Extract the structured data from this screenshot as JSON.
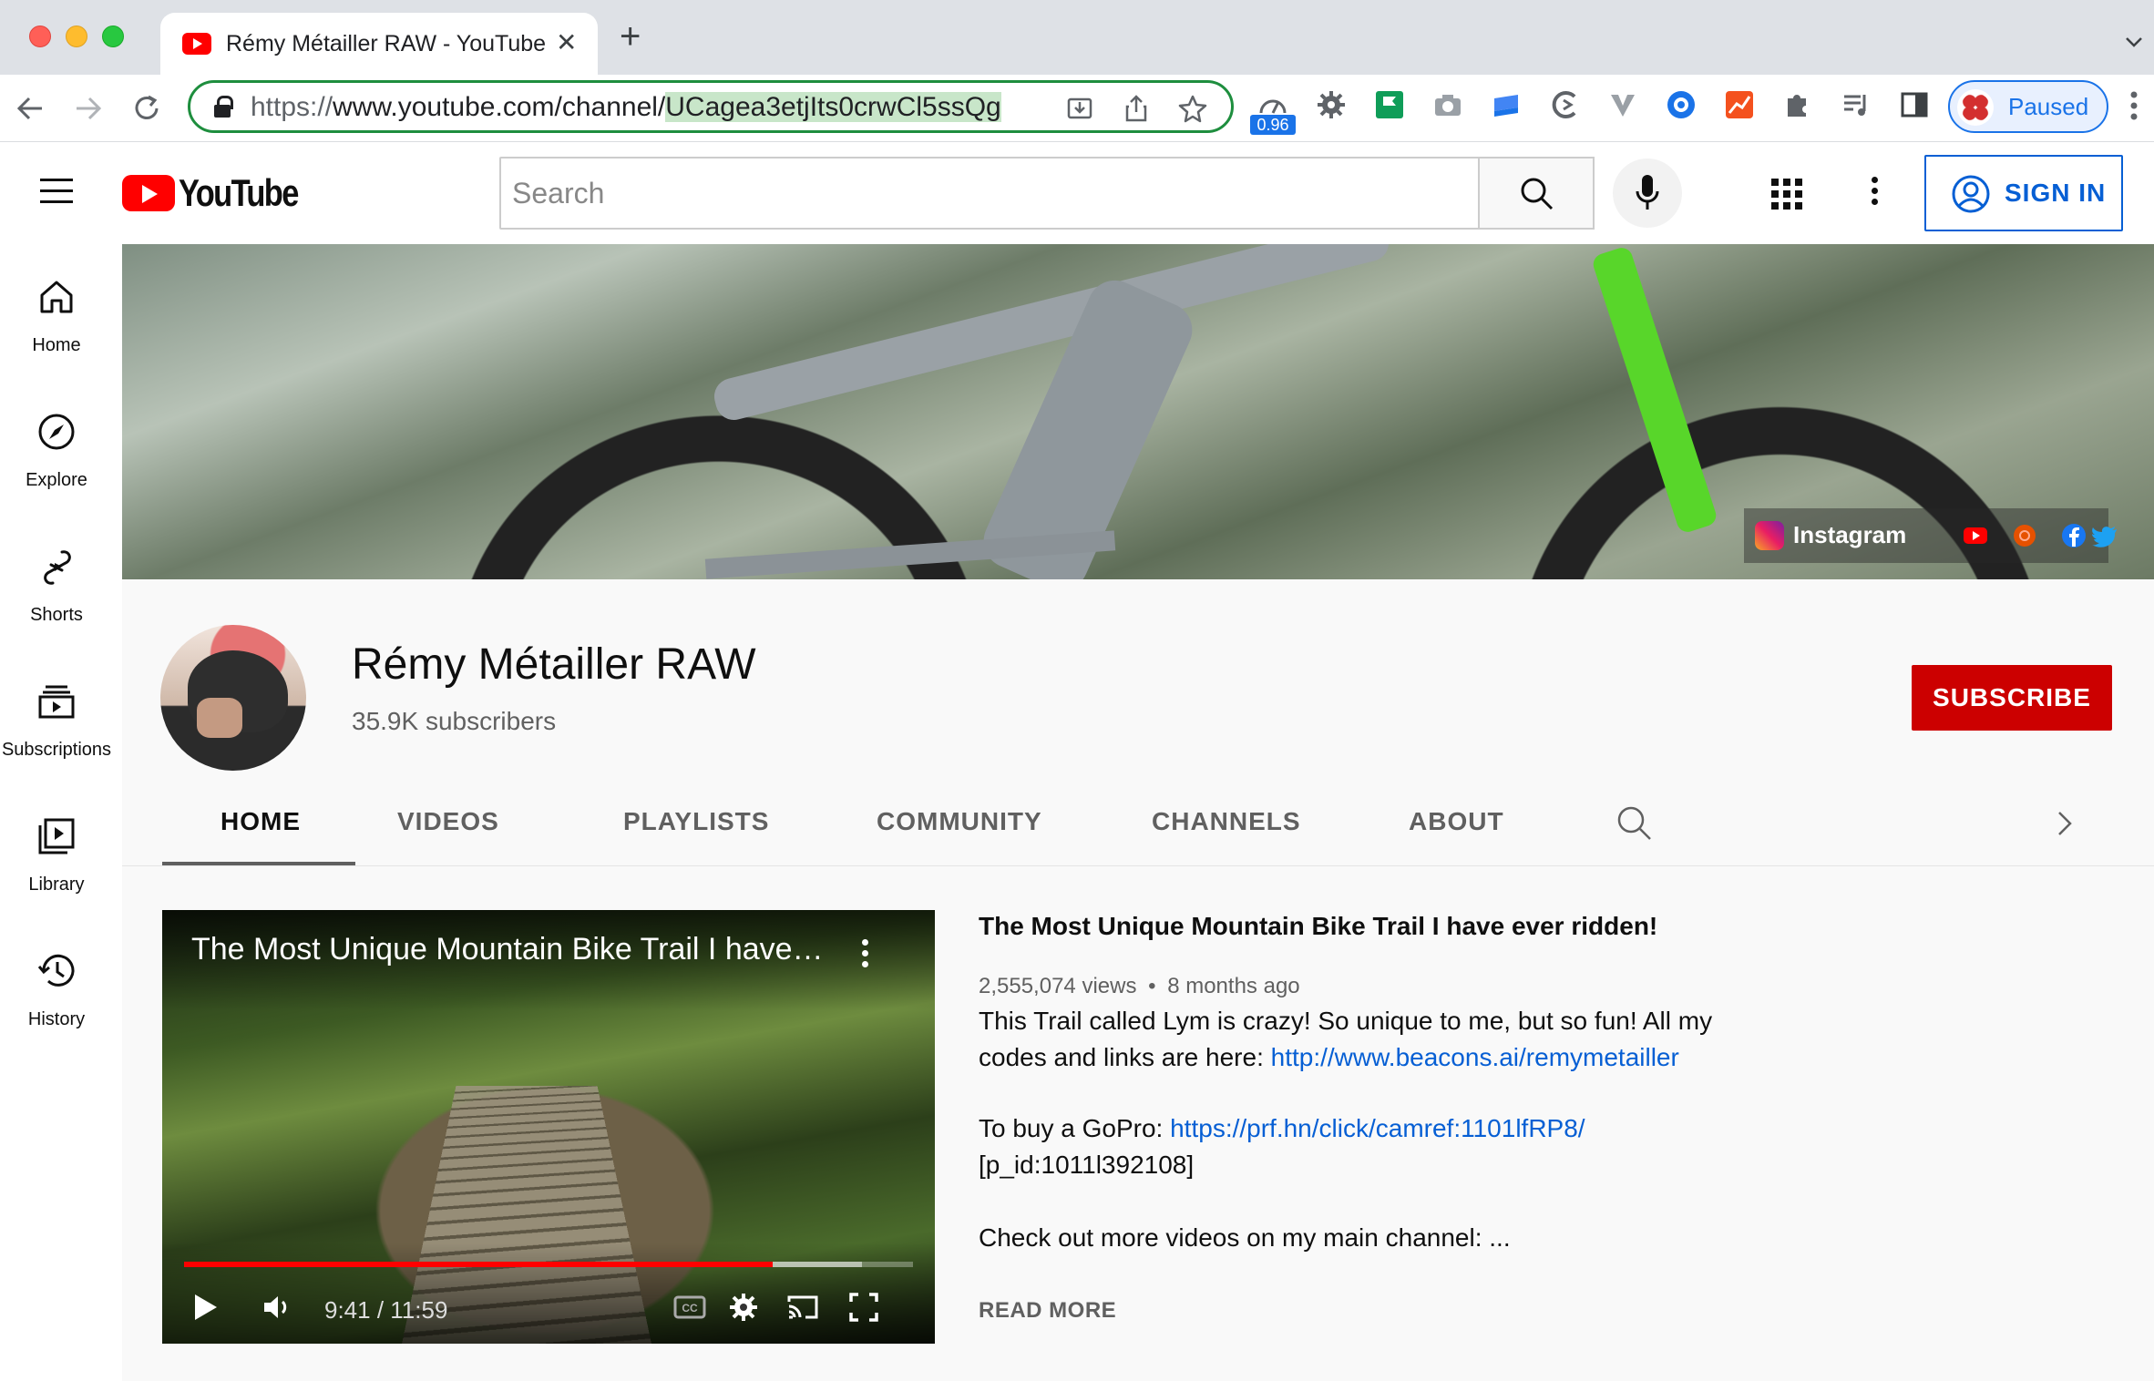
{
  "browser": {
    "tab_title": "Rémy Métailler RAW - YouTube",
    "tab_close": "✕",
    "new_tab": "+",
    "url_scheme": "https://",
    "url_host_path": "www.youtube.com/channel/",
    "url_selected": "UCagea3etjIts0crwCl5ssQg",
    "extension_badge": "0.96",
    "profile_label": "Paused"
  },
  "masthead": {
    "logo_text": "YouTube",
    "search_placeholder": "Search",
    "signin_label": "SIGN IN"
  },
  "guide": {
    "items": [
      {
        "label": "Home"
      },
      {
        "label": "Explore"
      },
      {
        "label": "Shorts"
      },
      {
        "label": "Subscriptions"
      },
      {
        "label": "Library"
      },
      {
        "label": "History"
      }
    ]
  },
  "banner": {
    "social_label": "Instagram"
  },
  "channel": {
    "name": "Rémy Métailler RAW",
    "subscribers": "35.9K subscribers",
    "subscribe_label": "SUBSCRIBE",
    "tabs": [
      "HOME",
      "VIDEOS",
      "PLAYLISTS",
      "COMMUNITY",
      "CHANNELS",
      "ABOUT"
    ],
    "active_tab": "HOME"
  },
  "featured": {
    "player_title": "The Most Unique Mountain Bike Trail I have ever ridden!",
    "time_display": "9:41 / 11:59",
    "progress_played": 0.808,
    "progress_loaded": 0.93,
    "title": "The Most Unique Mountain Bike Trail I have ever ridden!",
    "views": "2,555,074 views",
    "separator": "•",
    "age": "8 months ago",
    "desc_line1": "This Trail called Lym is crazy! So unique to me, but so fun! All my",
    "desc_line2_text": "codes and links  are here: ",
    "desc_line2_link": "http://www.beacons.ai/remymetailler",
    "desc_line3_text": "To buy a GoPro: ",
    "desc_line3_link": "https://prf.hn/click/camref:1101lfRP8/",
    "desc_line4": "[p_id:1011l392108]",
    "desc_line5": "Check out more videos on my main channel: ...",
    "read_more": "READ MORE"
  },
  "colors": {
    "yt_red": "#ff0000",
    "subscribe_red": "#cc0000",
    "link_blue": "#065fd4",
    "omnibox_green": "#1e8e3e"
  }
}
